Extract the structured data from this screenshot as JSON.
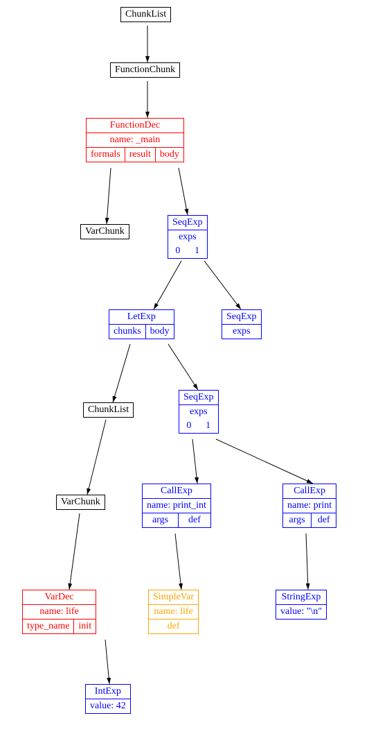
{
  "nodes": {
    "chunklist1": {
      "title": "ChunkList"
    },
    "functionchunk": {
      "title": "FunctionChunk"
    },
    "functiondec": {
      "title": "FunctionDec",
      "r1": "name: _main",
      "c1": "formals",
      "c2": "result",
      "c3": "body"
    },
    "varchunk1": {
      "title": "VarChunk"
    },
    "seqexp1": {
      "title": "SeqExp",
      "r1": "exps",
      "c1": "0",
      "c2": "1"
    },
    "letexp": {
      "title": "LetExp",
      "c1": "chunks",
      "c2": "body"
    },
    "seqexp2": {
      "title": "SeqExp",
      "r1": "exps"
    },
    "chunklist2": {
      "title": "ChunkList"
    },
    "seqexp3": {
      "title": "SeqExp",
      "r1": "exps",
      "c1": "0",
      "c2": "1"
    },
    "varchunk2": {
      "title": "VarChunk"
    },
    "callexp1": {
      "title": "CallExp",
      "r1": "name: print_int",
      "c1": "args",
      "c2": "def"
    },
    "callexp2": {
      "title": "CallExp",
      "r1": "name: print",
      "c1": "args",
      "c2": "def"
    },
    "vardec": {
      "title": "VarDec",
      "r1": "name: life",
      "c1": "type_name",
      "c2": "init"
    },
    "simplevar": {
      "title": "SimpleVar",
      "r1": "name: life",
      "r2": "def"
    },
    "stringexp": {
      "title": "StringExp",
      "r1": "value: \"\\n\""
    },
    "intexp": {
      "title": "IntExp",
      "r1": "value: 42"
    }
  }
}
